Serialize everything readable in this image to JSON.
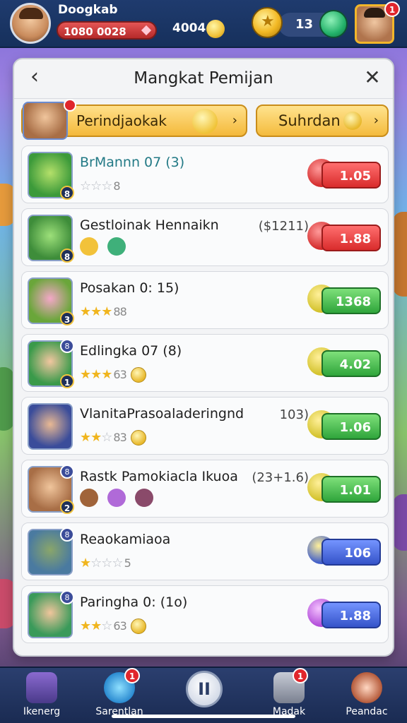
{
  "hud": {
    "player_name": "Doogkab",
    "player_id": "1080 0028",
    "gold_amount": "4004",
    "coins": "13",
    "friend_notification": "1"
  },
  "modal": {
    "title": "Mangkat Pemijan",
    "filter_left_label": "Perindjaokak",
    "filter_right_label": "Suhrdan"
  },
  "rows": [
    {
      "title": "BrMannn 07 (3)",
      "extra": "",
      "stars_filled": "",
      "stars_empty": "☆☆☆",
      "stars_num": "8",
      "price": "1.05",
      "price_color": "red",
      "title_color": "teal"
    },
    {
      "title": "Gestloinak Hennaikn",
      "extra": "($1211)",
      "stars_filled": "",
      "stars_empty": "",
      "stars_num": "",
      "price": "1.88",
      "price_color": "red",
      "title_color": "dark"
    },
    {
      "title": "Posakan 0: 15)",
      "extra": "",
      "stars_filled": "★★★",
      "stars_empty": "",
      "stars_num": "88",
      "price": "1368",
      "price_color": "green",
      "title_color": "dark"
    },
    {
      "title": "Edlingka 07 (8)",
      "extra": "",
      "stars_filled": "★★★",
      "stars_empty": "",
      "stars_num": "63",
      "price": "4.02",
      "price_color": "green",
      "title_color": "dark"
    },
    {
      "title": "VlanitaPrasoaladeringnd",
      "extra": "103)",
      "stars_filled": "★★",
      "stars_empty": "☆",
      "stars_num": "83",
      "price": "1.06",
      "price_color": "green",
      "title_color": "dark"
    },
    {
      "title": "Rastk Pamokiacla Ikuoa",
      "extra": "(23+1.6)",
      "stars_filled": "",
      "stars_empty": "",
      "stars_num": "",
      "price": "1.01",
      "price_color": "green",
      "title_color": "dark"
    },
    {
      "title": "Reaokamiaoa",
      "extra": "",
      "stars_filled": "★",
      "stars_empty": "☆☆☆",
      "stars_num": "5",
      "price": "106",
      "price_color": "blue",
      "title_color": "dark"
    },
    {
      "title": "Paringha 0: (1o)",
      "extra": "",
      "stars_filled": "★★",
      "stars_empty": "☆",
      "stars_num": "63",
      "price": "1.88",
      "price_color": "blue",
      "title_color": "dark"
    }
  ],
  "nav": {
    "item1": "Ikenerg",
    "item2": "Sarentlan",
    "item3": "Madak",
    "item4": "Peandac",
    "center_label": "II",
    "notif2": "1",
    "notif3": "1"
  },
  "colors": {
    "accent_gold": "#f4b93b",
    "price_red": "#d92c2c",
    "price_green": "#2fa53b",
    "price_blue": "#3553c9",
    "hud_bg": "#1f3b6e"
  }
}
